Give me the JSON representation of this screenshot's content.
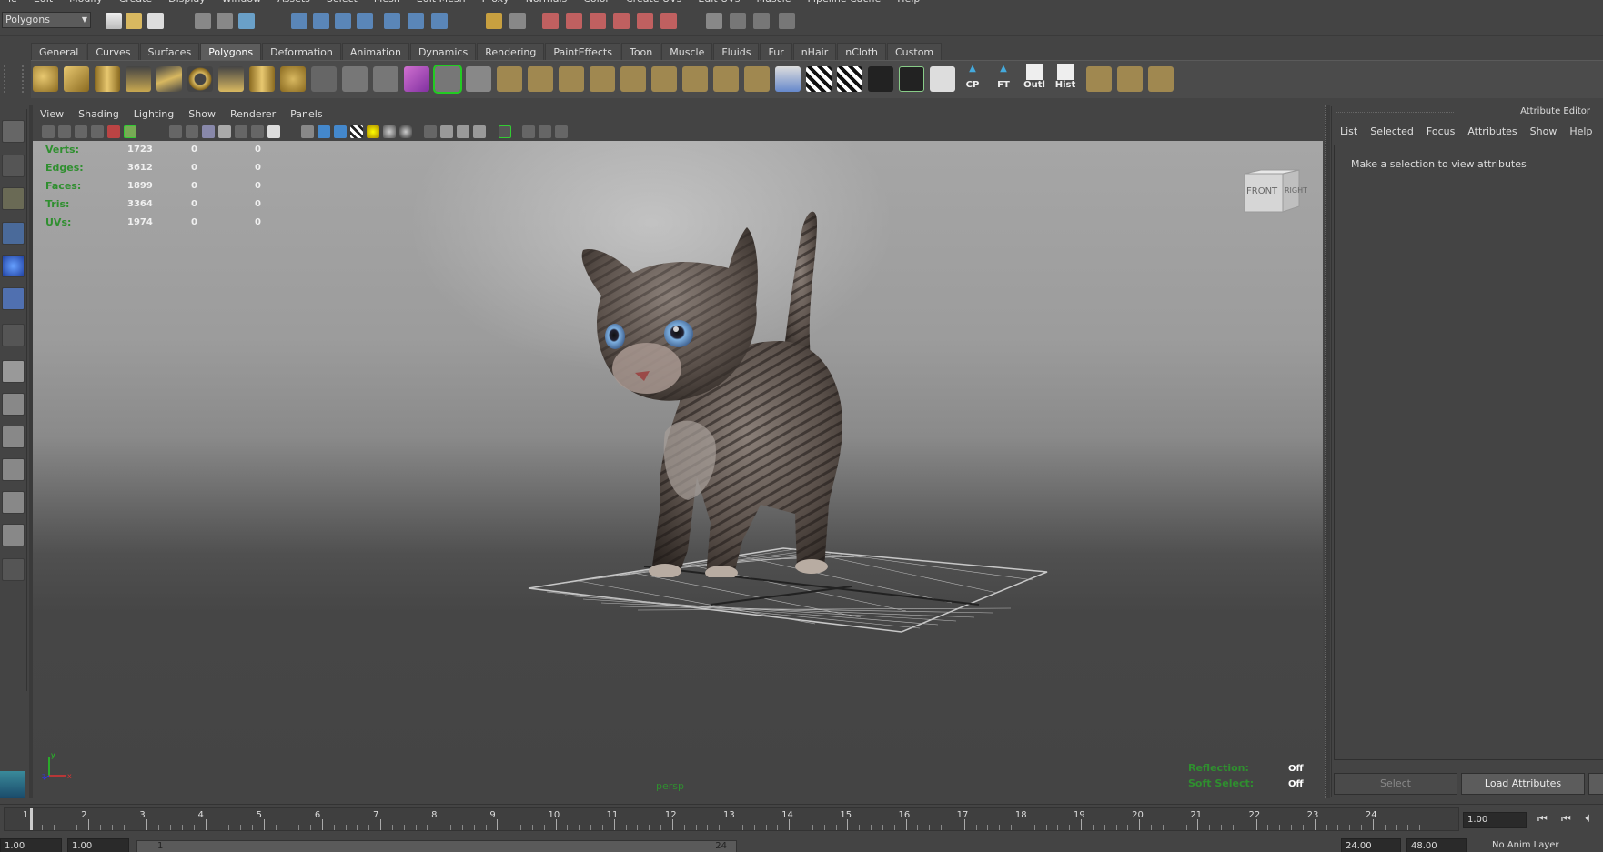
{
  "menubar": [
    "le",
    "Edit",
    "Modify",
    "Create",
    "Display",
    "Window",
    "Assets",
    "Select",
    "Mesh",
    "Edit Mesh",
    "Proxy",
    "Normals",
    "Color",
    "Create UVs",
    "Edit UVs",
    "Muscle",
    "Pipeline Cache",
    "Help"
  ],
  "status_line": {
    "mode": "Polygons"
  },
  "shelf": {
    "tabs": [
      "General",
      "Curves",
      "Surfaces",
      "Polygons",
      "Deformation",
      "Animation",
      "Dynamics",
      "Rendering",
      "PaintEffects",
      "Toon",
      "Muscle",
      "Fluids",
      "Fur",
      "nHair",
      "nCloth",
      "Custom"
    ],
    "active_tab": "Polygons",
    "text_buttons": [
      "CP",
      "FT",
      "Outl",
      "Hist"
    ]
  },
  "viewport": {
    "menu": [
      "View",
      "Shading",
      "Lighting",
      "Show",
      "Renderer",
      "Panels"
    ],
    "hud": [
      {
        "label": "Verts:",
        "values": [
          "1723",
          "0",
          "0"
        ]
      },
      {
        "label": "Edges:",
        "values": [
          "3612",
          "0",
          "0"
        ]
      },
      {
        "label": "Faces:",
        "values": [
          "1899",
          "0",
          "0"
        ]
      },
      {
        "label": "Tris:",
        "values": [
          "3364",
          "0",
          "0"
        ]
      },
      {
        "label": "UVs:",
        "values": [
          "1974",
          "0",
          "0"
        ]
      }
    ],
    "viewcube": {
      "front": "FRONT",
      "right": "RIGHT"
    },
    "camera": "persp",
    "reflection_label": "Reflection:",
    "reflection_value": "Off",
    "soft_select_label": "Soft Select:",
    "soft_select_value": "Off",
    "axes": {
      "x": "x",
      "y": "y",
      "z": "z"
    }
  },
  "attribute_editor": {
    "title": "Attribute Editor",
    "menu": [
      "List",
      "Selected",
      "Focus",
      "Attributes",
      "Show",
      "Help"
    ],
    "message": "Make a selection to view attributes",
    "select_button": "Select",
    "load_button": "Load Attributes"
  },
  "time_slider": {
    "ticks": [
      "1",
      "2",
      "3",
      "4",
      "5",
      "6",
      "7",
      "8",
      "9",
      "10",
      "11",
      "12",
      "13",
      "14",
      "15",
      "16",
      "17",
      "18",
      "19",
      "20",
      "21",
      "22",
      "23",
      "24"
    ],
    "current_frame": "1.00"
  },
  "range_slider": {
    "start": "1.00",
    "playback_start": "1.00",
    "range_start_label": "1",
    "range_end_label": "24",
    "playback_end": "24.00",
    "end": "48.00",
    "anim_layer": "No Anim Layer"
  },
  "colors": {
    "hud_label": "#2f8f2f",
    "background": "#444444"
  }
}
